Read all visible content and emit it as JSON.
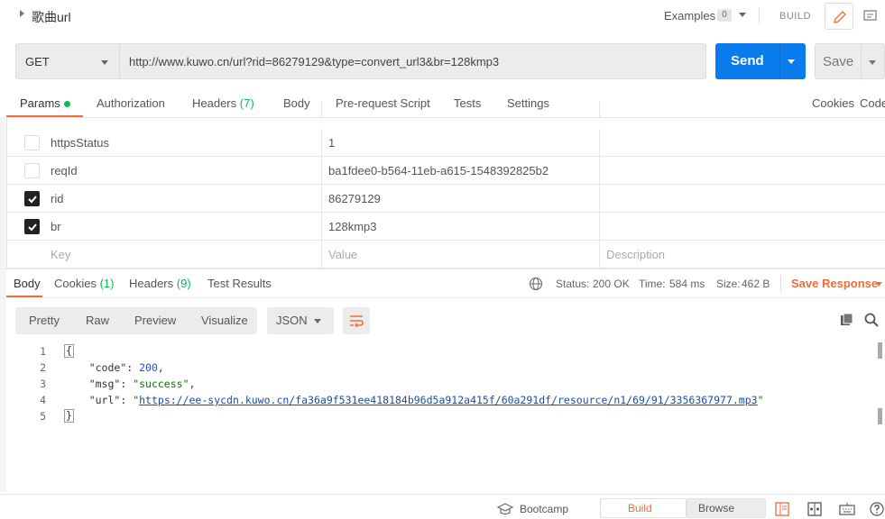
{
  "request": {
    "name": "歌曲url",
    "examples_label": "Examples",
    "examples_count": "0",
    "build_label": "BUILD",
    "method": "GET",
    "url": "http://www.kuwo.cn/url?rid=86279129&type=convert_url3&br=128kmp3",
    "send_label": "Send",
    "save_label": "Save"
  },
  "request_tabs": {
    "params": "Params",
    "authorization": "Authorization",
    "headers": "Headers",
    "headers_count": "(7)",
    "body": "Body",
    "prerequest": "Pre-request Script",
    "tests": "Tests",
    "settings": "Settings",
    "cookies": "Cookies",
    "code": "Code"
  },
  "params": {
    "rows": [
      {
        "key": "httpsStatus",
        "value": "1",
        "checked": false
      },
      {
        "key": "reqId",
        "value": "ba1fdee0-b564-11eb-a615-1548392825b2",
        "checked": false
      },
      {
        "key": "rid",
        "value": "86279129",
        "checked": true
      },
      {
        "key": "br",
        "value": "128kmp3",
        "checked": true
      }
    ],
    "placeholder_key": "Key",
    "placeholder_value": "Value",
    "placeholder_description": "Description"
  },
  "response_tabs": {
    "body": "Body",
    "cookies": "Cookies",
    "cookies_count": "(1)",
    "headers": "Headers",
    "headers_count": "(9)",
    "test_results": "Test Results"
  },
  "response_status": {
    "status_label": "Status:",
    "status_value": "200 OK",
    "time_label": "Time:",
    "time_value": "584 ms",
    "size_label": "Size:",
    "size_value": "462 B",
    "save_response": "Save Response"
  },
  "format_bar": {
    "pretty": "Pretty",
    "raw": "Raw",
    "preview": "Preview",
    "visualize": "Visualize",
    "json": "JSON"
  },
  "response_body": {
    "line_numbers": [
      "1",
      "2",
      "3",
      "4",
      "5"
    ],
    "open_brace": "{",
    "close_brace": "}",
    "code_key": "\"code\"",
    "code_value": "200",
    "msg_key": "\"msg\"",
    "msg_value": "\"success\"",
    "url_key": "\"url\"",
    "url_value": "https://ee-sycdn.kuwo.cn/fa36a9f531ee418184b96d5a912a415f/60a291df/resource/n1/69/91/3356367977.mp3"
  },
  "statusbar": {
    "bootcamp": "Bootcamp",
    "build": "Build",
    "browse": "Browse"
  },
  "colors": {
    "accent": "#f26b3a",
    "send_blue": "#097bed",
    "success_green": "#0cbb52"
  }
}
